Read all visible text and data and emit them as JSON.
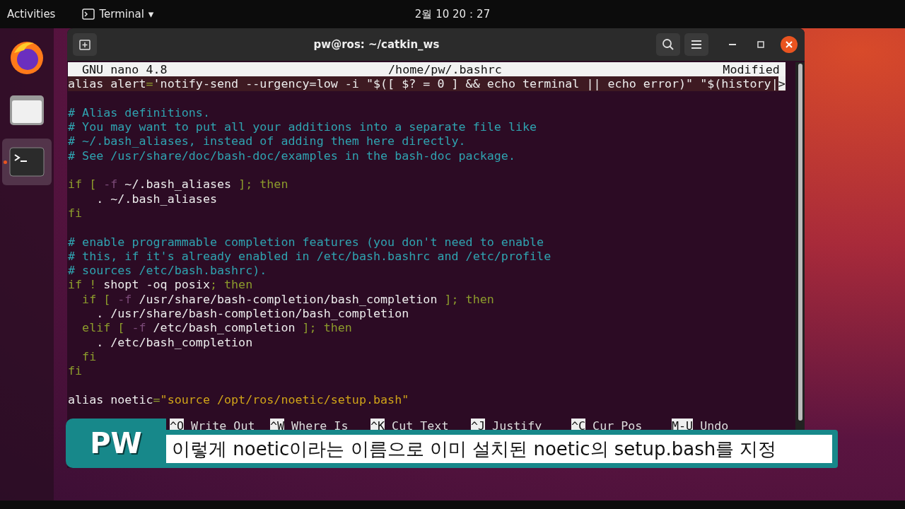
{
  "top_bar": {
    "activities": "Activities",
    "app_menu": {
      "label": "Terminal",
      "caret": "▾"
    },
    "clock": "2월 10 20：27"
  },
  "dock": {
    "items": [
      {
        "kind": "browser",
        "selected": false
      },
      {
        "kind": "files",
        "selected": false
      },
      {
        "kind": "terminal",
        "selected": true
      }
    ]
  },
  "window": {
    "title": "pw@ros: ~/catkin_ws"
  },
  "nano": {
    "header": {
      "version": "GNU nano 4.8",
      "file": "/home/pw/.bashrc",
      "status": "Modified"
    },
    "lines": [
      {
        "kind": "code",
        "spans": [
          {
            "text": "alias alert",
            "kind": "plain"
          },
          {
            "text": "=",
            "kind": "keyword"
          },
          {
            "text": "'notify-send --urgency=low -i \"$([ $? = 0 ] && echo terminal || echo error)\" \"$(history|",
            "kind": "plain"
          },
          {
            "text": ">",
            "kind": "marker"
          }
        ]
      },
      {
        "kind": "blank"
      },
      {
        "kind": "code",
        "spans": [
          {
            "text": "# Alias definitions.",
            "kind": "comment"
          }
        ]
      },
      {
        "kind": "code",
        "spans": [
          {
            "text": "# You may want to put all your additions into a separate file like",
            "kind": "comment"
          }
        ]
      },
      {
        "kind": "code",
        "spans": [
          {
            "text": "# ~/.bash_aliases, instead of adding them here directly.",
            "kind": "comment"
          }
        ]
      },
      {
        "kind": "code",
        "spans": [
          {
            "text": "# See /usr/share/doc/bash-doc/examples in the bash-doc package.",
            "kind": "comment"
          }
        ]
      },
      {
        "kind": "blank"
      },
      {
        "kind": "code",
        "spans": [
          {
            "text": "if [ ",
            "kind": "keyword"
          },
          {
            "text": "-f",
            "kind": "flag"
          },
          {
            "text": " ~/.bash_aliases ",
            "kind": "plain"
          },
          {
            "text": "]; then",
            "kind": "keyword"
          }
        ]
      },
      {
        "kind": "code",
        "spans": [
          {
            "text": "    . ~/.bash_aliases",
            "kind": "plain"
          }
        ]
      },
      {
        "kind": "code",
        "spans": [
          {
            "text": "fi",
            "kind": "keyword"
          }
        ]
      },
      {
        "kind": "blank"
      },
      {
        "kind": "code",
        "spans": [
          {
            "text": "# enable programmable completion features (you don't need to enable",
            "kind": "comment"
          }
        ]
      },
      {
        "kind": "code",
        "spans": [
          {
            "text": "# this, if it's already enabled in /etc/bash.bashrc and /etc/profile",
            "kind": "comment"
          }
        ]
      },
      {
        "kind": "code",
        "spans": [
          {
            "text": "# sources /etc/bash.bashrc).",
            "kind": "comment"
          }
        ]
      },
      {
        "kind": "code",
        "spans": [
          {
            "text": "if ! ",
            "kind": "keyword"
          },
          {
            "text": "shopt -oq posix",
            "kind": "plain"
          },
          {
            "text": "; then",
            "kind": "keyword"
          }
        ]
      },
      {
        "kind": "code",
        "spans": [
          {
            "text": "  if [ ",
            "kind": "keyword"
          },
          {
            "text": "-f",
            "kind": "flag"
          },
          {
            "text": " /usr/share/bash-completion/bash_completion ",
            "kind": "plain"
          },
          {
            "text": "]; then",
            "kind": "keyword"
          }
        ]
      },
      {
        "kind": "code",
        "spans": [
          {
            "text": "    . /usr/share/bash-completion/bash_completion",
            "kind": "plain"
          }
        ]
      },
      {
        "kind": "code",
        "spans": [
          {
            "text": "  elif [ ",
            "kind": "keyword"
          },
          {
            "text": "-f",
            "kind": "flag"
          },
          {
            "text": " /etc/bash_completion ",
            "kind": "plain"
          },
          {
            "text": "]; then",
            "kind": "keyword"
          }
        ]
      },
      {
        "kind": "code",
        "spans": [
          {
            "text": "    . /etc/bash_completion",
            "kind": "plain"
          }
        ]
      },
      {
        "kind": "code",
        "spans": [
          {
            "text": "  fi",
            "kind": "keyword"
          }
        ]
      },
      {
        "kind": "code",
        "spans": [
          {
            "text": "fi",
            "kind": "keyword"
          }
        ]
      },
      {
        "kind": "blank"
      },
      {
        "kind": "code",
        "spans": [
          {
            "text": "alias noetic",
            "kind": "plain"
          },
          {
            "text": "=",
            "kind": "keyword"
          },
          {
            "text": "\"source /opt/ros/noetic/setup.bash\"",
            "kind": "string"
          }
        ]
      },
      {
        "kind": "blank"
      }
    ],
    "shortcuts": [
      {
        "key": "^O",
        "label": "Write Out"
      },
      {
        "key": "^W",
        "label": "Where Is"
      },
      {
        "key": "^K",
        "label": "Cut Text"
      },
      {
        "key": "^J",
        "label": "Justify"
      },
      {
        "key": "^C",
        "label": "Cur Pos"
      },
      {
        "key": "M-U",
        "label": "Undo"
      }
    ]
  },
  "subtitle": {
    "badge": "PW",
    "text": "이렇게 noetic이라는 이름으로 이미 설치된 noetic의 setup.bash를 지정"
  }
}
